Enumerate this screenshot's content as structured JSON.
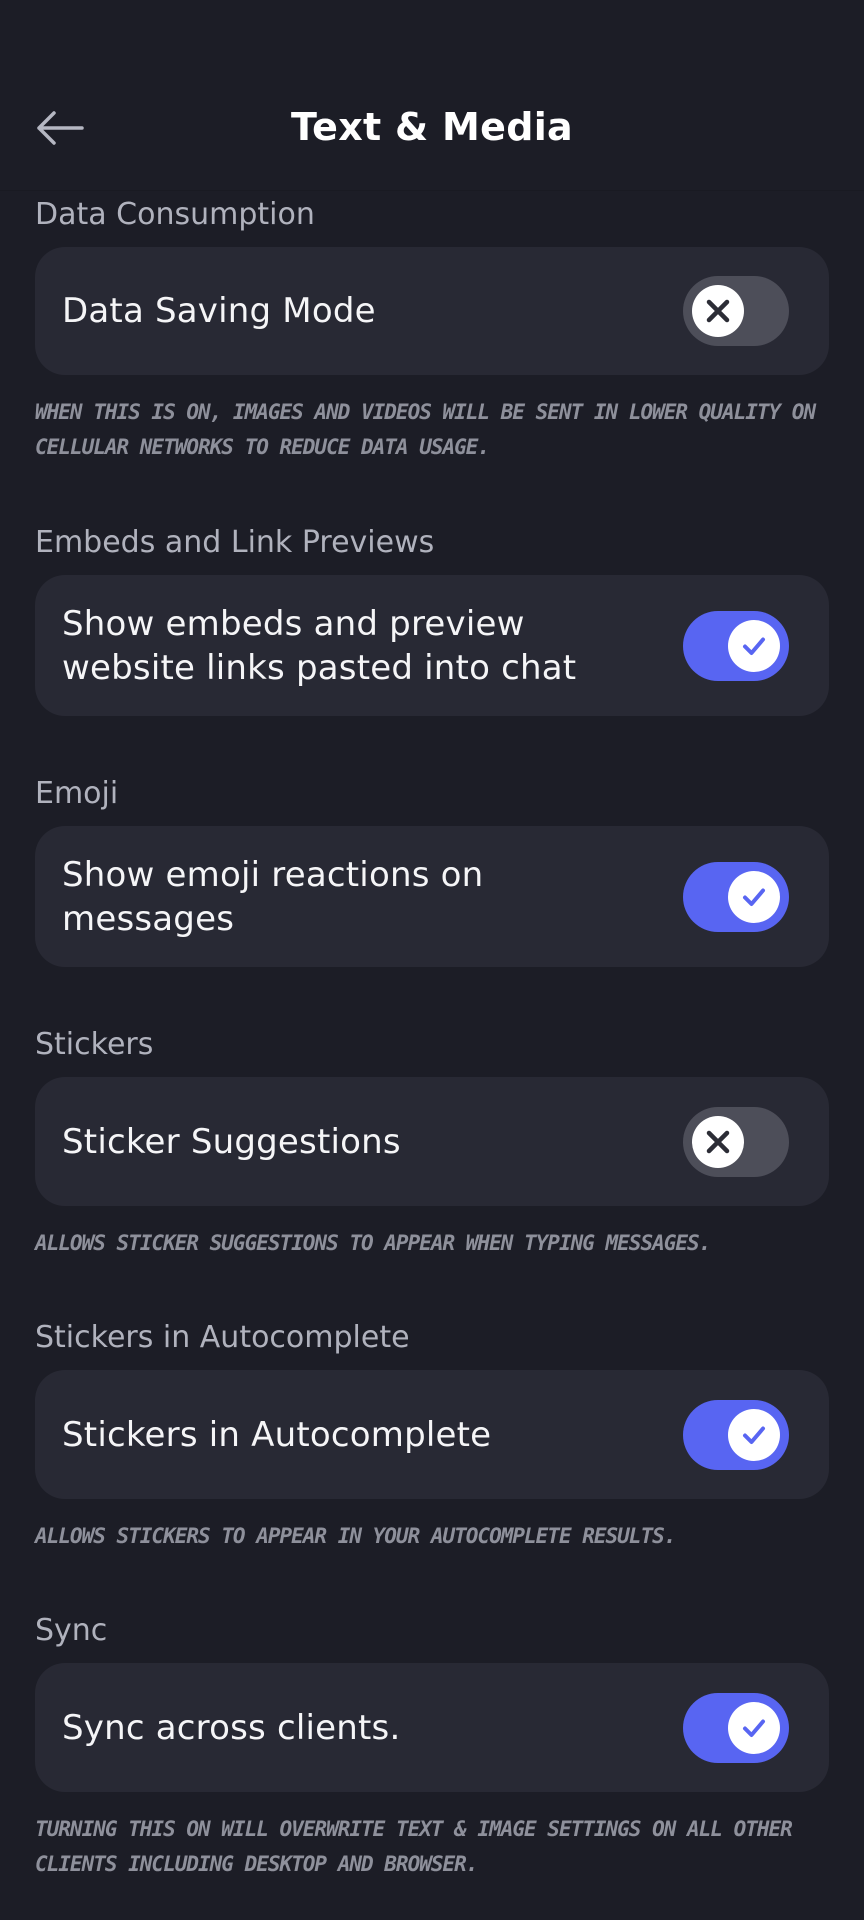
{
  "header": {
    "title": "Text & Media",
    "back_icon": "arrow-left-icon"
  },
  "colors": {
    "background": "#1c1d26",
    "card": "#282934",
    "accent": "#5865f2",
    "toggle_off": "#4d4e59",
    "section_title": "#b0b2bd",
    "note_text": "#8e909b"
  },
  "sections": [
    {
      "title": "Data Consumption",
      "label": "Data Saving Mode",
      "enabled": false,
      "note": "When this is on, images and videos will be sent in lower quality on cellular networks to reduce data usage."
    },
    {
      "title": "Embeds and Link Previews",
      "label": "Show embeds and preview website links pasted into chat",
      "enabled": true
    },
    {
      "title": "Emoji",
      "label": "Show emoji reactions on messages",
      "enabled": true
    },
    {
      "title": "Stickers",
      "label": "Sticker Suggestions",
      "enabled": false,
      "note": "Allows sticker suggestions to appear when typing messages."
    },
    {
      "title": "Stickers in Autocomplete",
      "label": "Stickers in Autocomplete",
      "enabled": true,
      "note": "Allows stickers to appear in your autocomplete results."
    },
    {
      "title": "Sync",
      "label": "Sync across clients.",
      "enabled": true,
      "note": "Turning this on will overwrite text & image settings on all other clients including desktop and browser."
    }
  ]
}
